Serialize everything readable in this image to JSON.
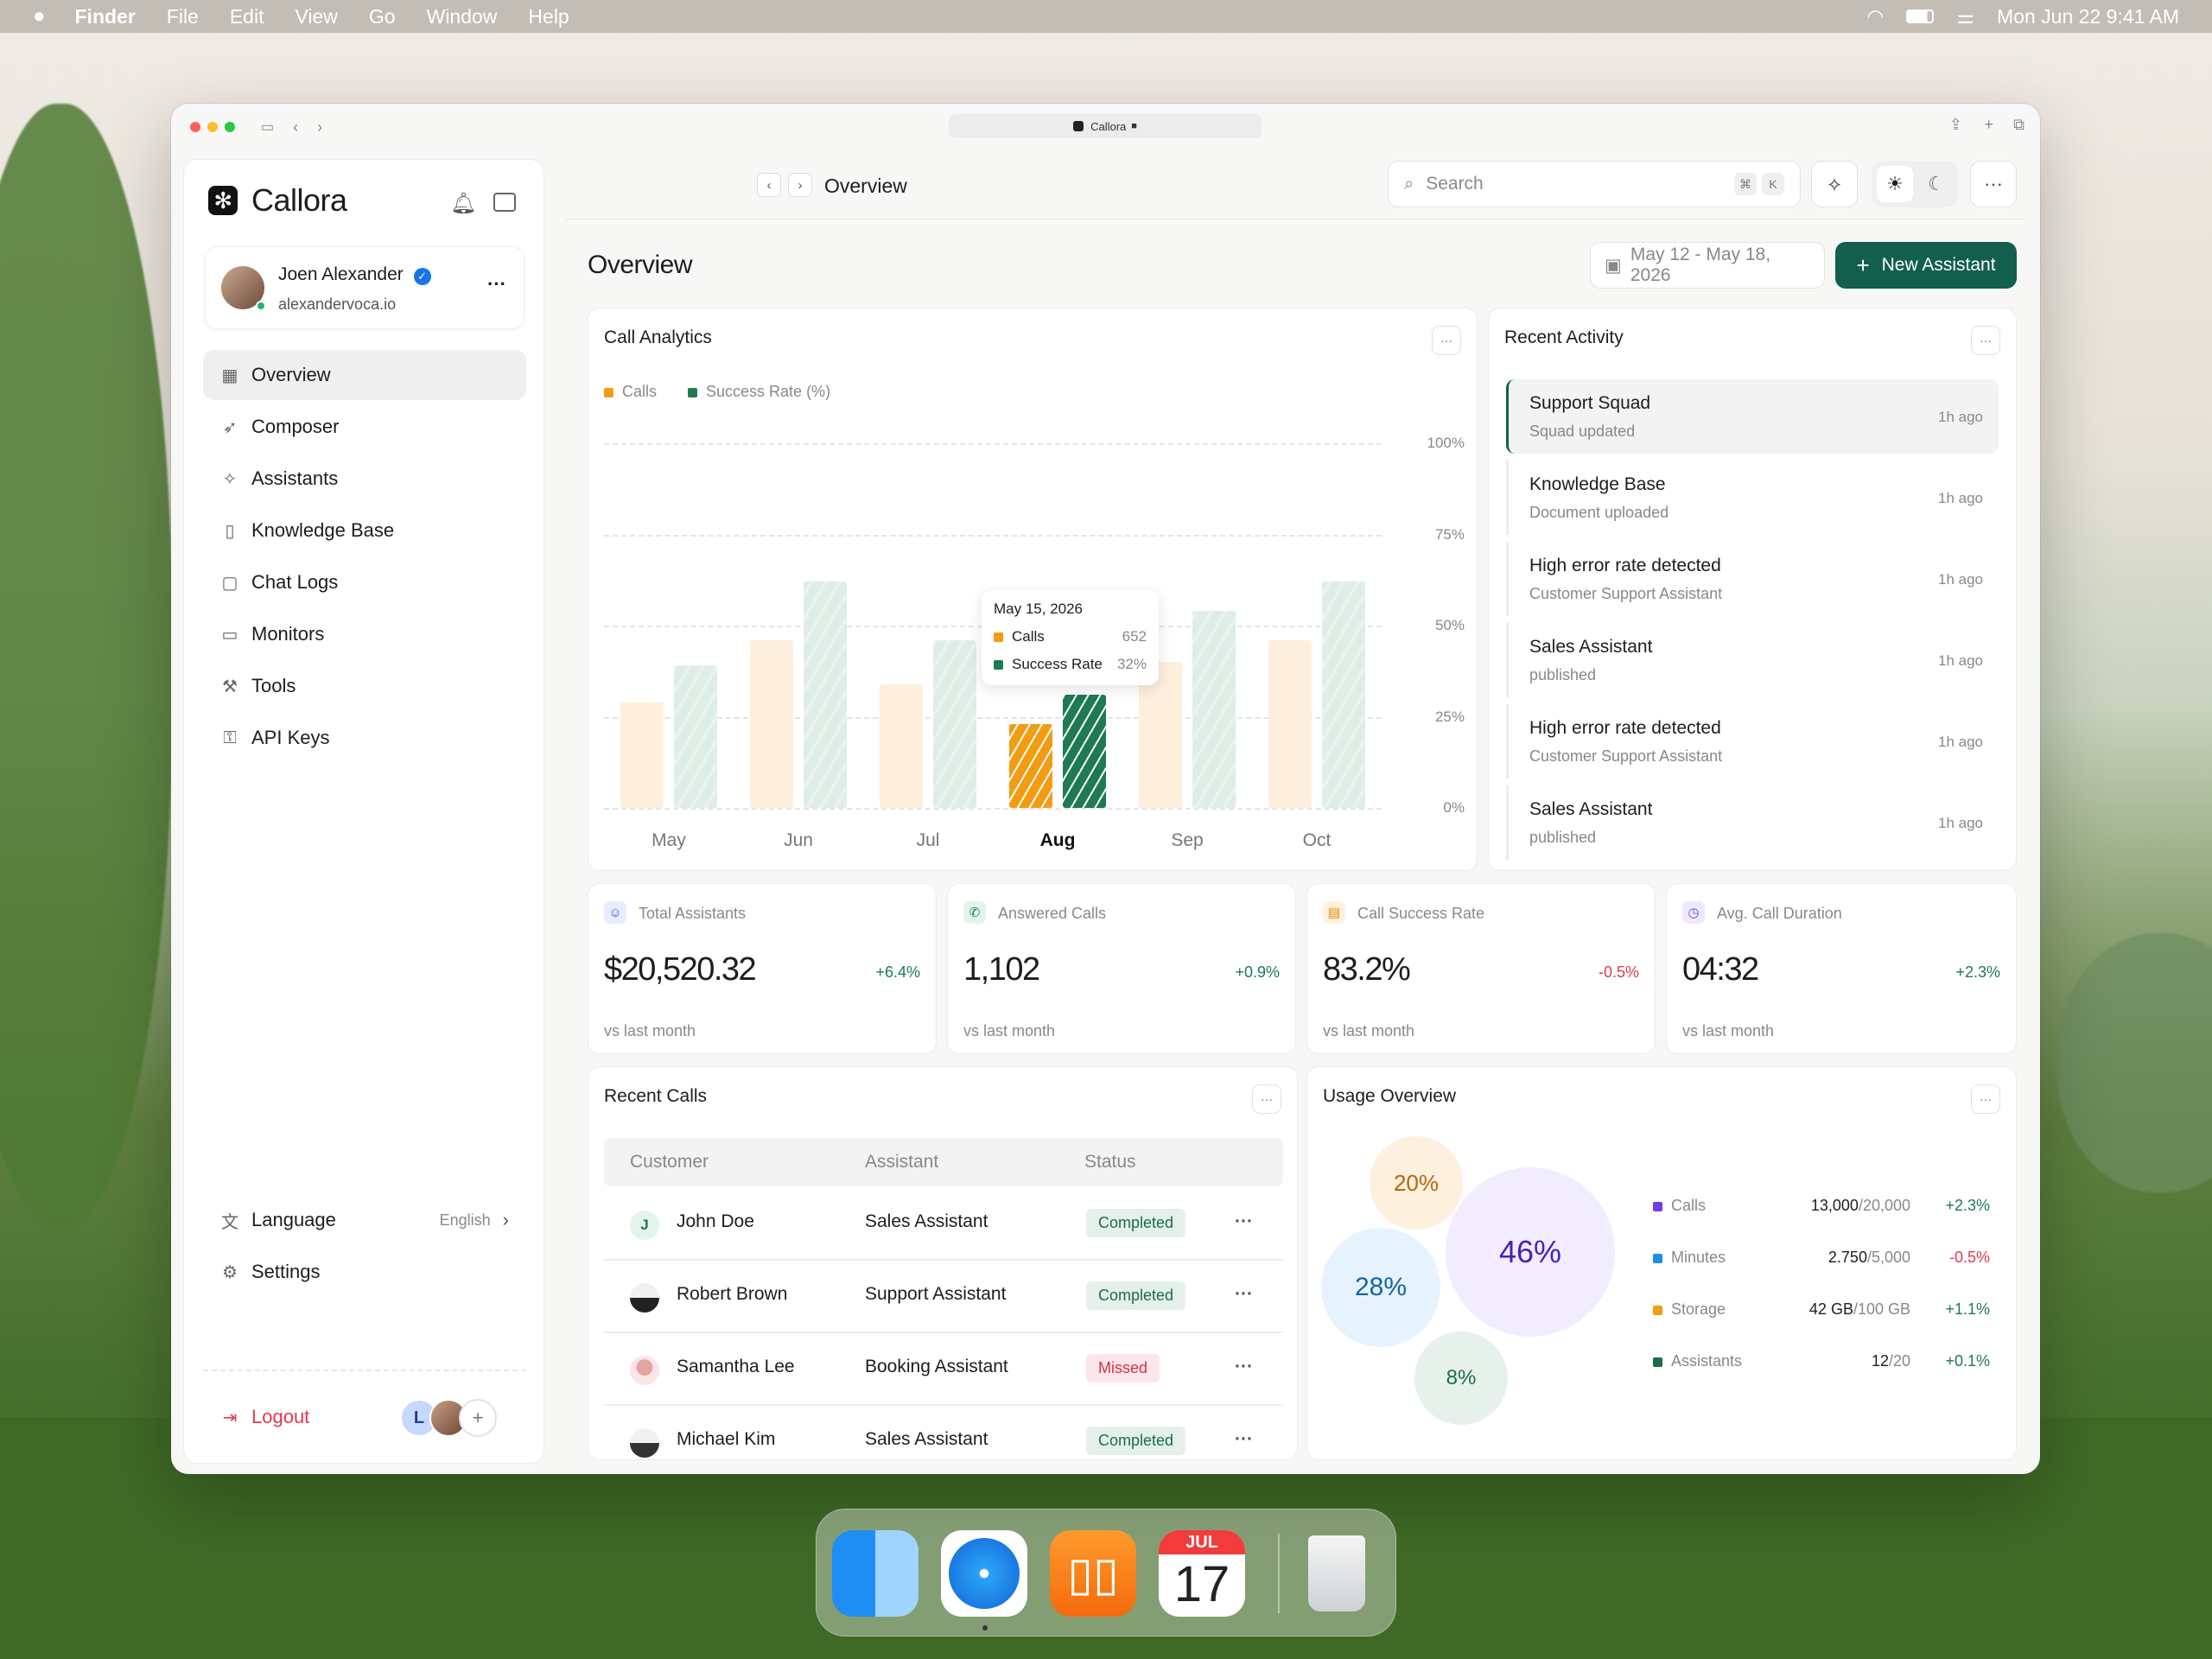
{
  "menubar": {
    "app": "Finder",
    "items": [
      "File",
      "Edit",
      "View",
      "Go",
      "Window",
      "Help"
    ],
    "datetime": "Mon Jun 22  9:41 AM"
  },
  "browser": {
    "url_title": "Callora"
  },
  "sidebar": {
    "brand": "Callora",
    "user": {
      "name": "Joen Alexander",
      "domain": "alexandervoca.io"
    },
    "nav": [
      {
        "label": "Overview",
        "icon": "grid-icon"
      },
      {
        "label": "Composer",
        "icon": "rocket-icon"
      },
      {
        "label": "Assistants",
        "icon": "sparkle-icon"
      },
      {
        "label": "Knowledge Base",
        "icon": "book-icon"
      },
      {
        "label": "Chat Logs",
        "icon": "chat-icon"
      },
      {
        "label": "Monitors",
        "icon": "monitor-icon"
      },
      {
        "label": "Tools",
        "icon": "tool-icon"
      },
      {
        "label": "API Keys",
        "icon": "key-icon"
      }
    ],
    "language_label": "Language",
    "language_value": "English",
    "settings_label": "Settings",
    "logout_label": "Logout",
    "team_initial": "L"
  },
  "header": {
    "breadcrumb": "Overview",
    "search_placeholder": "Search",
    "kbd_cmd": "⌘",
    "kbd_k": "K"
  },
  "page": {
    "title": "Overview",
    "date_range": "May 12 - May 18, 2026",
    "new_button": "New Assistant"
  },
  "call_analytics": {
    "title": "Call Analytics",
    "legend": [
      "Calls",
      "Success Rate (%)"
    ],
    "tooltip": {
      "date": "May 15, 2026",
      "calls_label": "Calls",
      "calls_value": "652",
      "rate_label": "Success Rate",
      "rate_value": "32%"
    }
  },
  "chart_data": {
    "type": "bar",
    "categories": [
      "May",
      "Jun",
      "Jul",
      "Aug",
      "Sep",
      "Oct"
    ],
    "highlight": "Aug",
    "y_ticks": [
      "100%",
      "75%",
      "50%",
      "25%",
      "0%"
    ],
    "ylim": [
      0,
      100
    ],
    "series": [
      {
        "name": "Calls",
        "color": "#f39c12",
        "values": [
          29,
          46,
          34,
          23,
          40,
          46
        ]
      },
      {
        "name": "Success Rate (%)",
        "color": "#1e7a52",
        "values": [
          39,
          62,
          46,
          31,
          54,
          62
        ]
      }
    ]
  },
  "recent_activity": {
    "title": "Recent Activity",
    "items": [
      {
        "title": "Support Squad",
        "sub": "Squad updated",
        "time": "1h ago"
      },
      {
        "title": "Knowledge Base",
        "sub": "Document uploaded",
        "time": "1h ago"
      },
      {
        "title": "High error rate detected",
        "sub": "Customer Support Assistant",
        "time": "1h ago"
      },
      {
        "title": "Sales Assistant",
        "sub": "published",
        "time": "1h ago"
      },
      {
        "title": "High error rate detected",
        "sub": "Customer Support Assistant",
        "time": "1h ago"
      },
      {
        "title": "Sales Assistant",
        "sub": "published",
        "time": "1h ago"
      }
    ]
  },
  "stats": [
    {
      "label": "Total Assistants",
      "value": "$20,520.32",
      "delta": "+6.4%",
      "sub": "vs last month",
      "positive": true
    },
    {
      "label": "Answered Calls",
      "value": "1,102",
      "delta": "+0.9%",
      "sub": "vs last month",
      "positive": true
    },
    {
      "label": "Call Success Rate",
      "value": "83.2%",
      "delta": "-0.5%",
      "sub": "vs last month",
      "positive": false
    },
    {
      "label": "Avg. Call Duration",
      "value": "04:32",
      "delta": "+2.3%",
      "sub": "vs last month",
      "positive": true
    }
  ],
  "recent_calls": {
    "title": "Recent Calls",
    "columns": [
      "Customer",
      "Assistant",
      "Status"
    ],
    "rows": [
      {
        "customer": "John Doe",
        "initial": "J",
        "assistant": "Sales Assistant",
        "status": "Completed"
      },
      {
        "customer": "Robert Brown",
        "initial": "",
        "assistant": "Support Assistant",
        "status": "Completed"
      },
      {
        "customer": "Samantha Lee",
        "initial": "",
        "assistant": "Booking Assistant",
        "status": "Missed"
      },
      {
        "customer": "Michael Kim",
        "initial": "",
        "assistant": "Sales Assistant",
        "status": "Completed"
      }
    ]
  },
  "usage": {
    "title": "Usage Overview",
    "bubbles": [
      "20%",
      "46%",
      "28%",
      "8%"
    ],
    "rows": [
      {
        "label": "Calls",
        "used": "13,000",
        "total": "/20,000",
        "delta": "+2.3%",
        "color": "#6d3fe0",
        "positive": true
      },
      {
        "label": "Minutes",
        "used": "2.750",
        "total": "/5,000",
        "delta": "-0.5%",
        "color": "#1a8fe8",
        "positive": false
      },
      {
        "label": "Storage",
        "used": "42 GB",
        "total": "/100 GB",
        "delta": "+1.1%",
        "color": "#f39c12",
        "positive": true
      },
      {
        "label": "Assistants",
        "used": "12",
        "total": "/20",
        "delta": "+0.1%",
        "color": "#1e6b4a",
        "positive": true
      }
    ]
  },
  "dock": {
    "calendar_month": "JUL",
    "calendar_day": "17"
  }
}
